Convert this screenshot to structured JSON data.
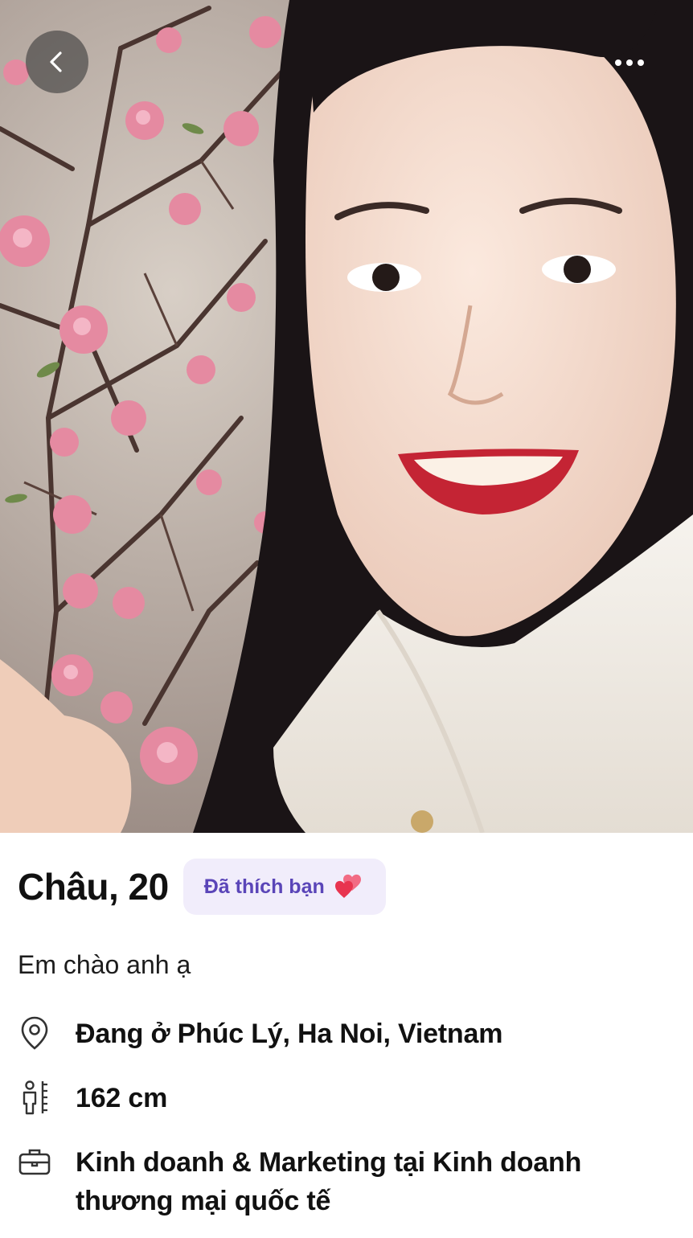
{
  "profile": {
    "name_age": "Châu, 20",
    "liked_badge": "Đã thích bạn",
    "bio": "Em chào anh ạ",
    "location": "Đang ở Phúc Lý, Ha Noi, Vietnam",
    "height": "162 cm",
    "job": "Kinh doanh & Marketing tại Kinh doanh thương mại quốc tế"
  },
  "icons": {
    "back": "chevron-left-icon",
    "more": "more-horizontal-icon",
    "liked": "two-hearts-icon",
    "location": "location-pin-icon",
    "height": "height-ruler-icon",
    "job": "briefcase-icon"
  },
  "colors": {
    "badge_bg": "#f1edfb",
    "badge_text": "#5a45b8",
    "heart": "#e8344f"
  }
}
